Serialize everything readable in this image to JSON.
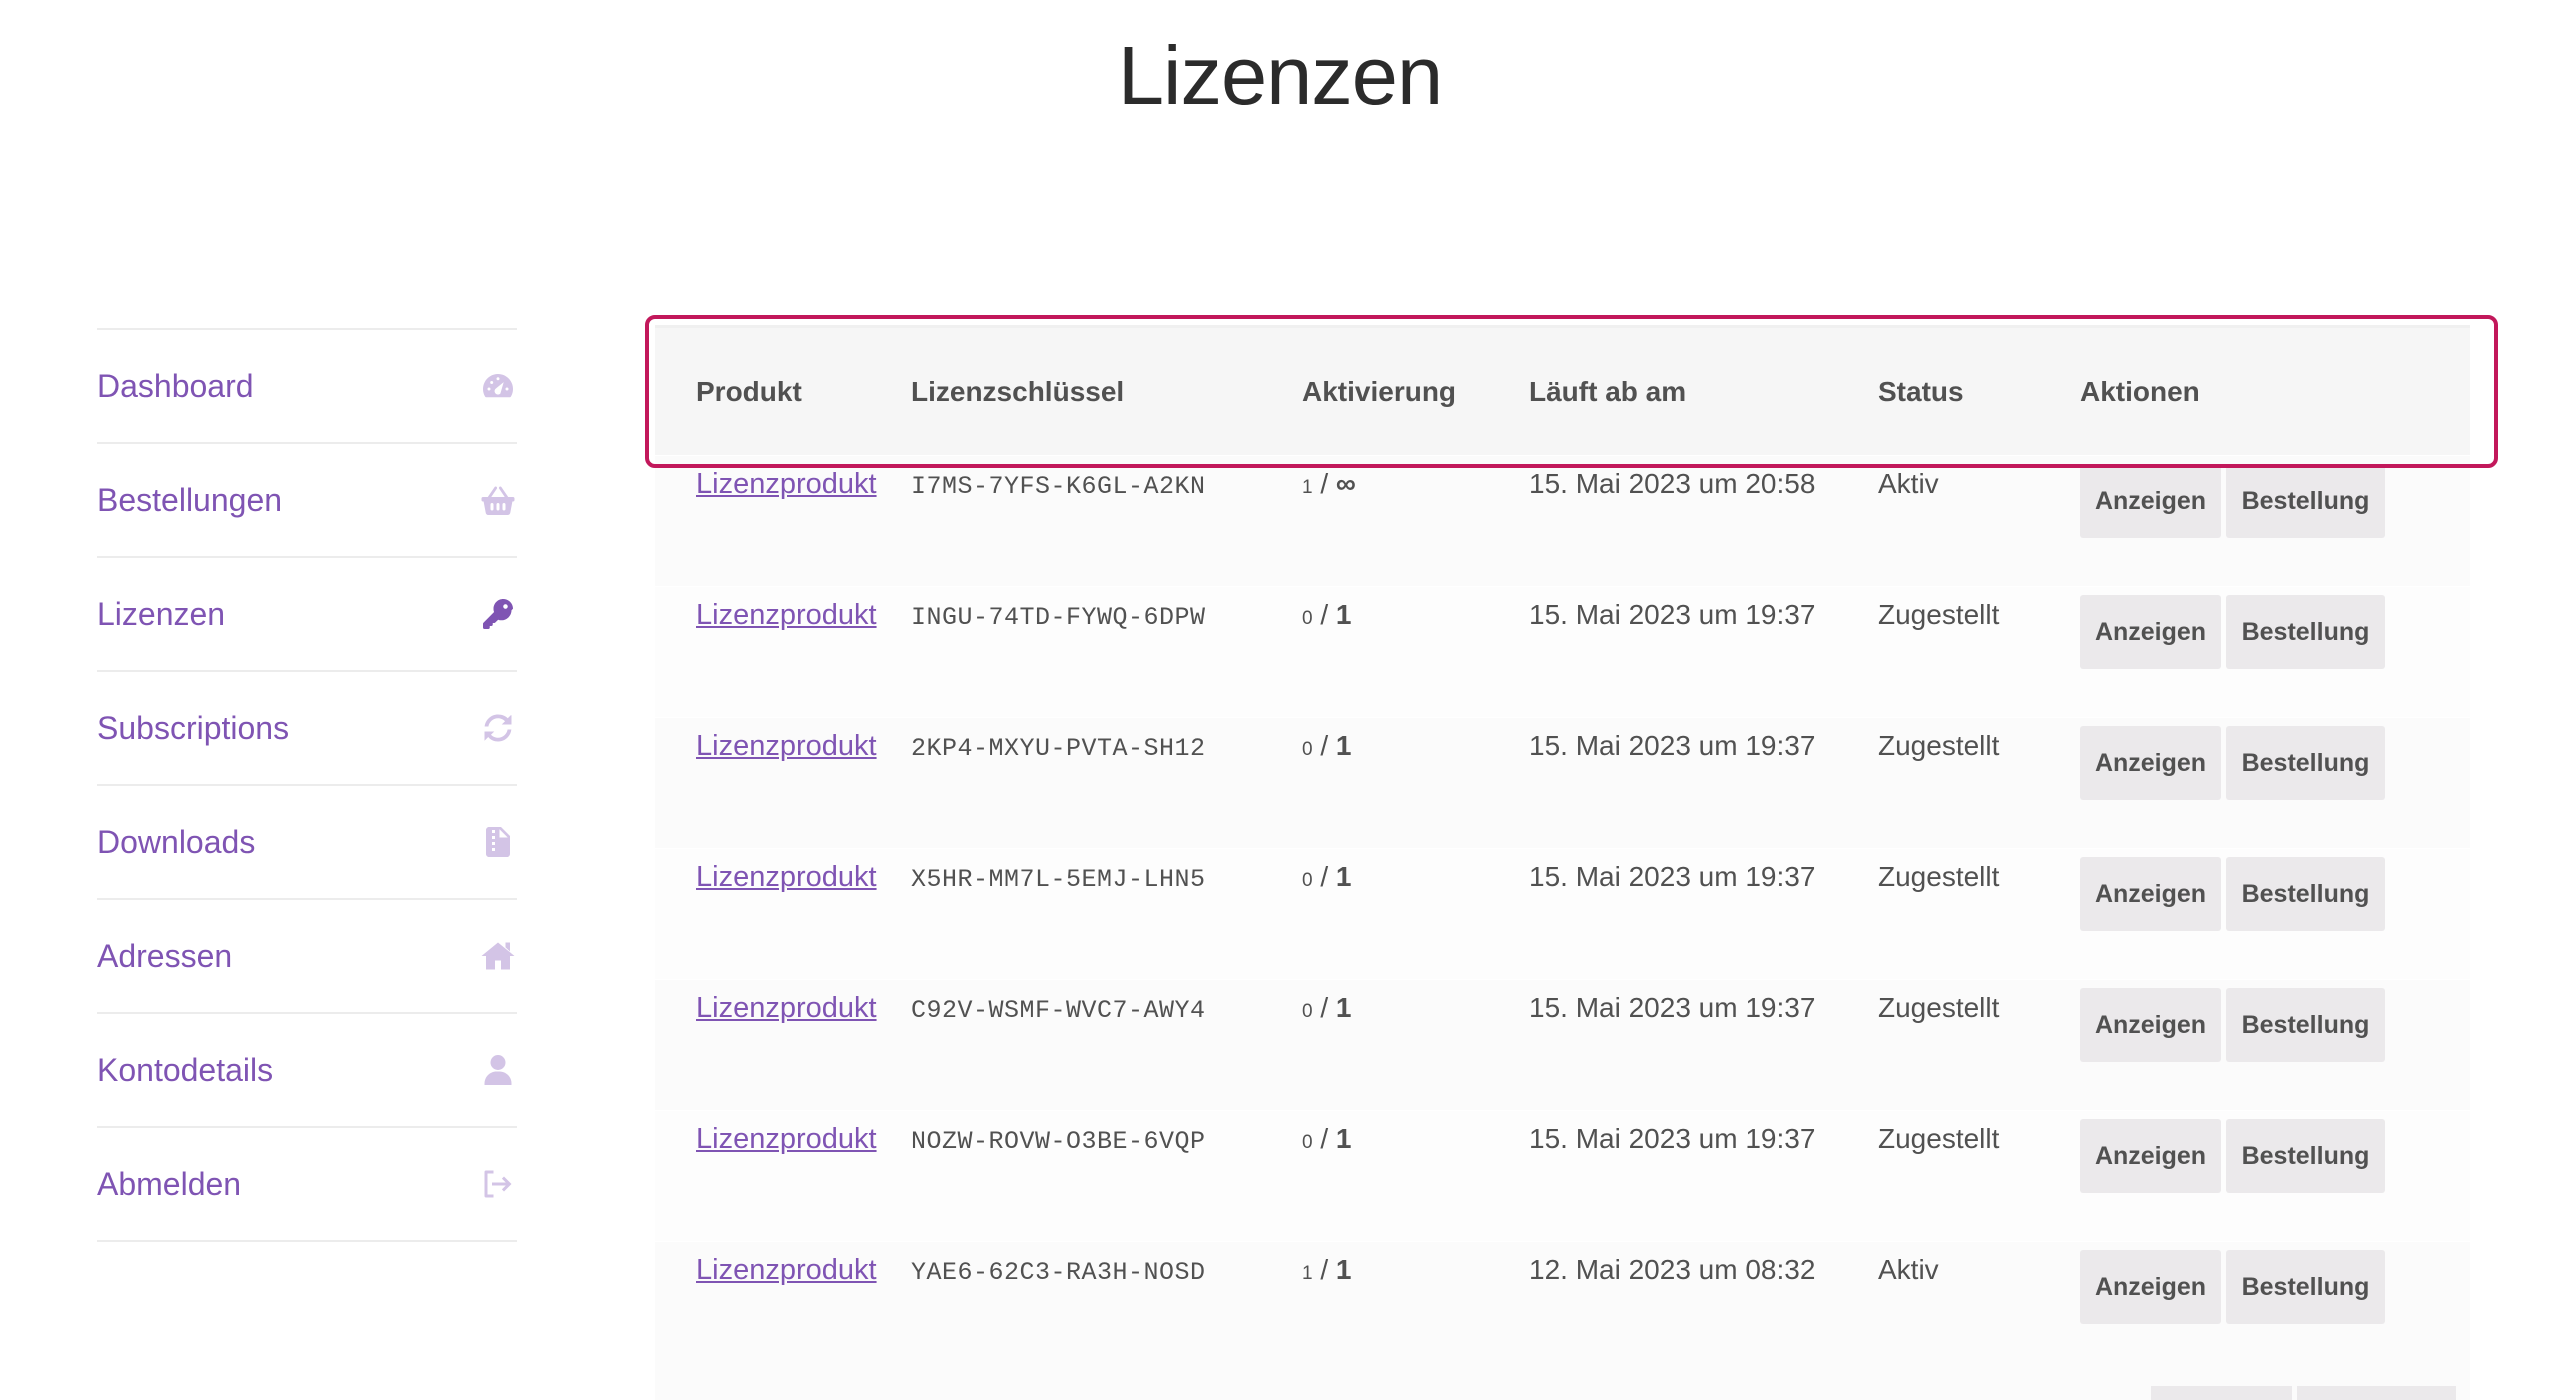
{
  "page": {
    "title": "Lizenzen"
  },
  "colors": {
    "accent": "#7f54b3",
    "highlight": "#c2185b",
    "button_bg": "#ebe9eb"
  },
  "sidebar": {
    "items": [
      {
        "label": "Dashboard",
        "icon": "dashboard-gauge-icon",
        "active": false
      },
      {
        "label": "Bestellungen",
        "icon": "basket-icon",
        "active": false
      },
      {
        "label": "Lizenzen",
        "icon": "key-icon",
        "active": true
      },
      {
        "label": "Subscriptions",
        "icon": "refresh-icon",
        "active": false
      },
      {
        "label": "Downloads",
        "icon": "file-icon",
        "active": false
      },
      {
        "label": "Adressen",
        "icon": "home-icon",
        "active": false
      },
      {
        "label": "Kontodetails",
        "icon": "user-icon",
        "active": false
      },
      {
        "label": "Abmelden",
        "icon": "sign-out-icon",
        "active": false
      }
    ]
  },
  "table": {
    "headers": {
      "product": "Produkt",
      "key": "Lizenzschlüssel",
      "activation": "Aktivierung",
      "expires": "Läuft ab am",
      "status": "Status",
      "actions": "Aktionen"
    },
    "rows": [
      {
        "product": "Lizenzprodukt",
        "key": "I7MS-7YFS-K6GL-A2KN",
        "act_used": "1",
        "act_sep": " / ",
        "act_max": "∞",
        "expires": "15. Mai 2023 um 20:58",
        "status": "Aktiv",
        "view": "Anzeigen",
        "order": "Bestellung"
      },
      {
        "product": "Lizenzprodukt",
        "key": "INGU-74TD-FYWQ-6DPW",
        "act_used": "0",
        "act_sep": " / ",
        "act_max": "1",
        "expires": "15. Mai 2023 um 19:37",
        "status": "Zugestellt",
        "view": "Anzeigen",
        "order": "Bestellung"
      },
      {
        "product": "Lizenzprodukt",
        "key": "2KP4-MXYU-PVTA-SH12",
        "act_used": "0",
        "act_sep": " / ",
        "act_max": "1",
        "expires": "15. Mai 2023 um 19:37",
        "status": "Zugestellt",
        "view": "Anzeigen",
        "order": "Bestellung"
      },
      {
        "product": "Lizenzprodukt",
        "key": "X5HR-MM7L-5EMJ-LHN5",
        "act_used": "0",
        "act_sep": " / ",
        "act_max": "1",
        "expires": "15. Mai 2023 um 19:37",
        "status": "Zugestellt",
        "view": "Anzeigen",
        "order": "Bestellung"
      },
      {
        "product": "Lizenzprodukt",
        "key": "C92V-WSMF-WVC7-AWY4",
        "act_used": "0",
        "act_sep": " / ",
        "act_max": "1",
        "expires": "15. Mai 2023 um 19:37",
        "status": "Zugestellt",
        "view": "Anzeigen",
        "order": "Bestellung"
      },
      {
        "product": "Lizenzprodukt",
        "key": "NOZW-ROVW-O3BE-6VQP",
        "act_used": "0",
        "act_sep": " / ",
        "act_max": "1",
        "expires": "15. Mai 2023 um 19:37",
        "status": "Zugestellt",
        "view": "Anzeigen",
        "order": "Bestellung"
      },
      {
        "product": "Lizenzprodukt",
        "key": "YAE6-62C3-RA3H-NOSD",
        "act_used": "1",
        "act_sep": " / ",
        "act_max": "1",
        "expires": "12. Mai 2023 um 08:32",
        "status": "Aktiv",
        "view": "Anzeigen",
        "order": "Bestellung"
      }
    ]
  }
}
